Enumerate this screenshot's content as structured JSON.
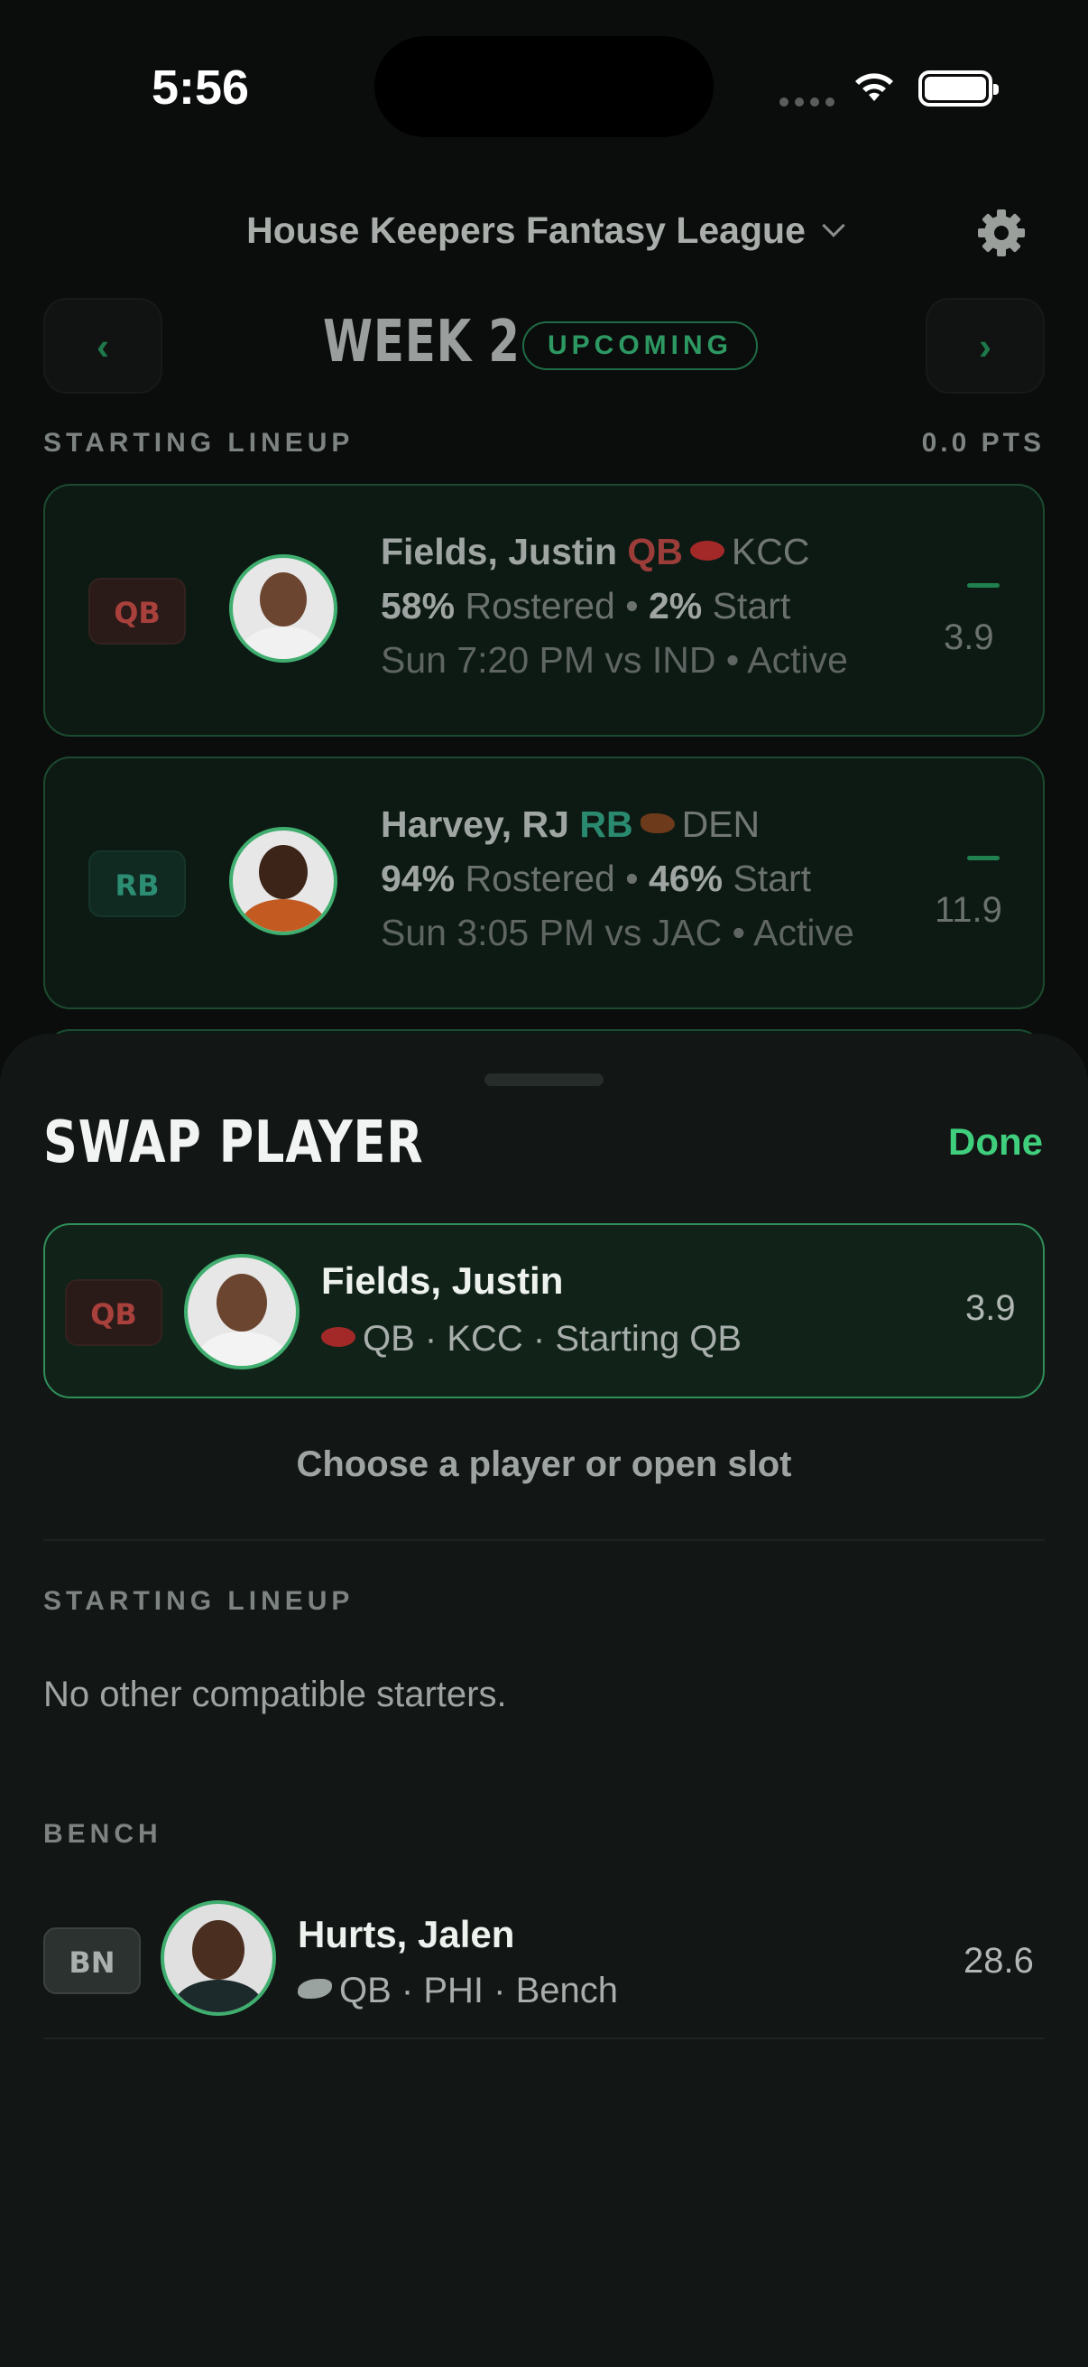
{
  "status": {
    "time": "5:56"
  },
  "header": {
    "league_name": "House Keepers Fantasy League",
    "prev": "‹",
    "next": "›",
    "week": "WEEK 2",
    "badge": "UPCOMING"
  },
  "lineup": {
    "label": "STARTING LINEUP",
    "points": "0.0 PTS",
    "players": [
      {
        "slot": "QB",
        "name": "Fields, Justin",
        "pos": "QB",
        "team": "KCC",
        "rostered_pct": "58%",
        "rostered_label": "Rostered •",
        "start_pct": "2%",
        "start_label": "Start",
        "game": "Sun 7:20 PM vs IND • Active",
        "proj": "3.9",
        "logo": "chiefs-logo"
      },
      {
        "slot": "RB",
        "name": "Harvey, RJ",
        "pos": "RB",
        "team": "DEN",
        "rostered_pct": "94%",
        "rostered_label": "Rostered •",
        "start_pct": "46%",
        "start_label": "Start",
        "game": "Sun 3:05 PM vs JAC • Active",
        "proj": "11.9",
        "logo": "broncos-logo"
      }
    ]
  },
  "sheet": {
    "title": "SWAP PLAYER",
    "done": "Done",
    "selected": {
      "slot": "QB",
      "name": "Fields, Justin",
      "sub": "QB · KCC · Starting QB",
      "pts": "3.9"
    },
    "prompt": "Choose a player or open slot",
    "starting_label": "STARTING LINEUP",
    "no_starters": "No other compatible starters.",
    "bench_label": "BENCH",
    "bench": [
      {
        "slot": "BN",
        "name": "Hurts, Jalen",
        "sub": "QB · PHI · Bench",
        "pts": "28.6"
      }
    ]
  },
  "colors": {
    "accent": "#3fcf7d",
    "qb": "#a8403c",
    "rb": "#2c8d73",
    "background": "#0b0d0c",
    "sheet": "#121614"
  }
}
